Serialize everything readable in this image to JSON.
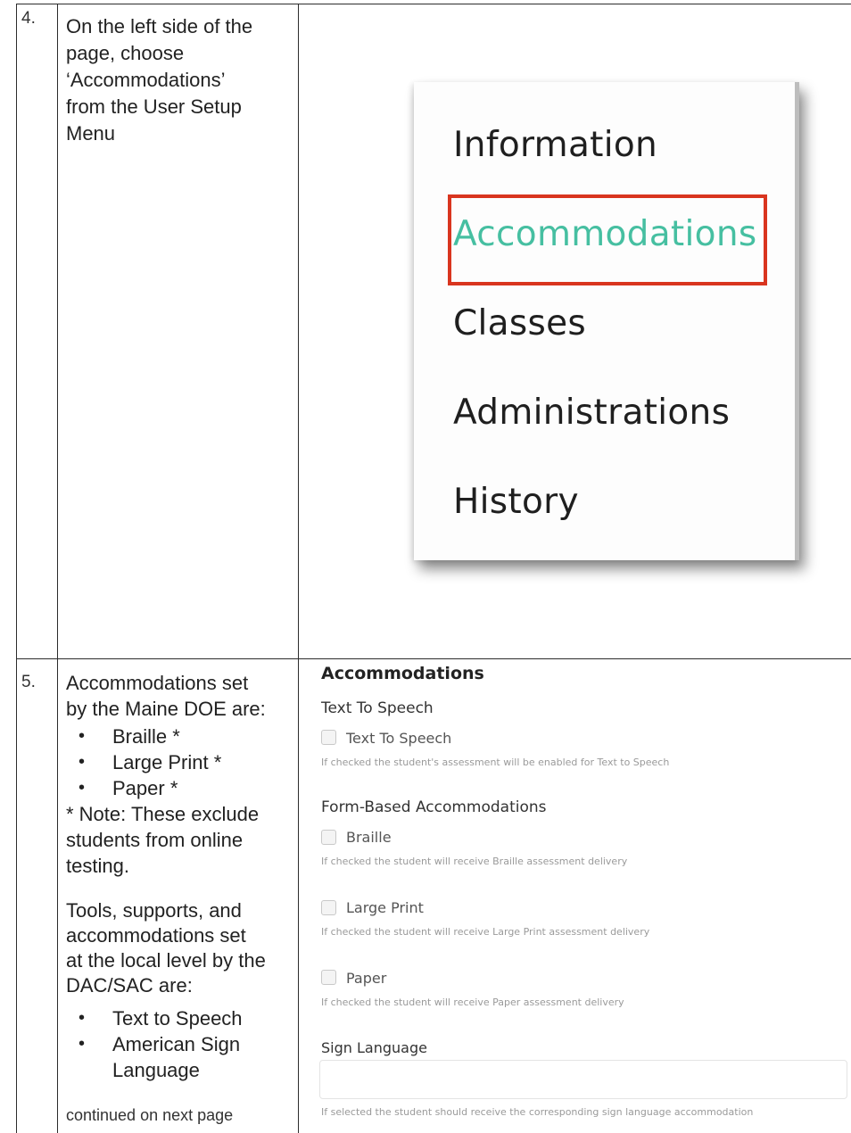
{
  "rows": [
    {
      "number": "4.",
      "instruction": [
        "On the left side of the",
        "page, choose",
        "‘Accommodations’",
        "from the User Setup",
        "Menu"
      ],
      "menu": {
        "items": [
          "Information",
          "Accommodations",
          "Classes",
          "Administrations",
          "History"
        ],
        "active_item": "Accommodations",
        "highlight_color": "#d9351f",
        "active_color": "#46bfa1"
      }
    },
    {
      "number": "5.",
      "intro": [
        "Accommodations set",
        "by the Maine DOE are:"
      ],
      "doe_list": [
        "Braille *",
        "Large Print *",
        "Paper *"
      ],
      "note": [
        "* Note: These exclude",
        "students from online",
        "testing."
      ],
      "local_intro": [
        "Tools, supports, and",
        "accommodations set",
        "at the local level by the",
        "DAC/SAC are:"
      ],
      "local_list": [
        "Text to Speech",
        "American Sign",
        "Language"
      ],
      "continued": "continued on next page",
      "form": {
        "title": "Accommodations",
        "tts_section": "Text To Speech",
        "tts_option": "Text To Speech",
        "tts_desc": "If checked the student's assessment will be enabled for Text to Speech",
        "form_section": "Form-Based Accommodations",
        "options": [
          {
            "label": "Braille",
            "desc": "If checked the student will receive Braille assessment delivery"
          },
          {
            "label": "Large Print",
            "desc": "If checked the student will receive Large Print assessment delivery"
          },
          {
            "label": "Paper",
            "desc": "If checked the student will receive Paper assessment delivery"
          }
        ],
        "sign_section": "Sign Language",
        "sign_desc": "If selected the student should receive the corresponding sign language accommodation"
      }
    }
  ]
}
